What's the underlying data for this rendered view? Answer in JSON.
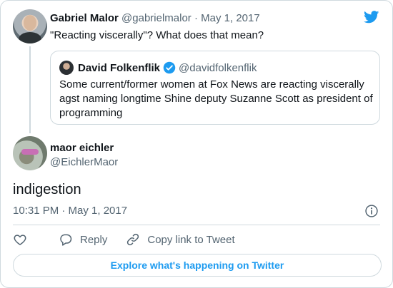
{
  "parent_tweet": {
    "name": "Gabriel Malor",
    "handle": "@gabrielmalor",
    "separator": "·",
    "date": "May 1, 2017",
    "text": "\"Reacting viscerally\"? What does that mean?"
  },
  "quoted_tweet": {
    "name": "David Folkenflik",
    "handle": "@davidfolkenflik",
    "text": "Some current/former women at Fox News are reacting viscerally agst naming longtime Shine deputy Suzanne Scott as president of programming"
  },
  "tweet": {
    "name": "maor eichler",
    "handle": "@EichlerMaor",
    "text": "indigestion",
    "timestamp": "10:31 PM · May 1, 2017"
  },
  "actions": {
    "reply_label": "Reply",
    "copy_link_label": "Copy link to Tweet"
  },
  "explore_label": "Explore what's happening on Twitter",
  "colors": {
    "accent": "#1d9bf0",
    "secondary_text": "#536471",
    "border": "#cfd9de"
  },
  "icons": [
    "twitter-logo-icon",
    "verified-badge-icon",
    "info-icon",
    "heart-icon",
    "reply-icon",
    "link-icon"
  ]
}
